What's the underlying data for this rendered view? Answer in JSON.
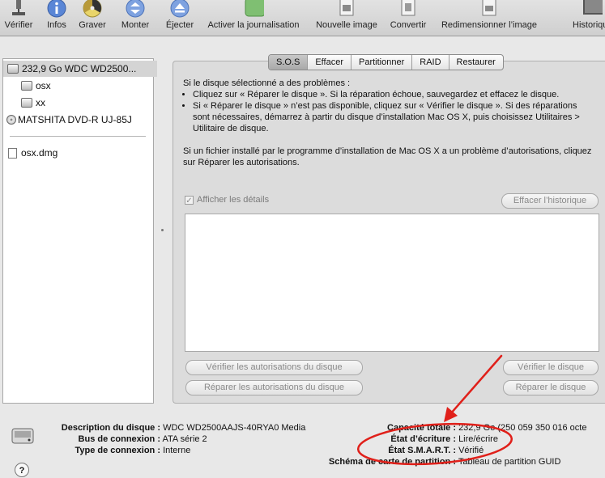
{
  "toolbar": {
    "items": [
      {
        "label": "Vérifier",
        "icon": "microscope-icon"
      },
      {
        "label": "Infos",
        "icon": "info-icon"
      },
      {
        "label": "Graver",
        "icon": "burn-icon"
      },
      {
        "label": "Monter",
        "icon": "mount-icon"
      },
      {
        "label": "Éjecter",
        "icon": "eject-icon"
      },
      {
        "label": "Activer la journalisation",
        "icon": "journal-icon"
      },
      {
        "label": "Nouvelle image",
        "icon": "new-image-icon"
      },
      {
        "label": "Convertir",
        "icon": "convert-icon"
      },
      {
        "label": "Redimensionner l’image",
        "icon": "resize-image-icon"
      },
      {
        "label": "Historique",
        "icon": "log-icon"
      }
    ]
  },
  "sidebar": {
    "items": [
      {
        "label": "232,9 Go WDC WD2500...",
        "kind": "disk"
      },
      {
        "label": "osx",
        "kind": "volume"
      },
      {
        "label": "xx",
        "kind": "volume"
      },
      {
        "label": "MATSHITA DVD-R UJ-85J",
        "kind": "optical"
      },
      {
        "label": "osx.dmg",
        "kind": "image"
      }
    ]
  },
  "tabs": [
    "S.O.S",
    "Effacer",
    "Partitionner",
    "RAID",
    "Restaurer"
  ],
  "sos": {
    "intro": "Si le disque sélectionné a des problèmes :",
    "bullets": [
      "Cliquez sur « Réparer le disque ». Si la réparation échoue, sauvegardez et effacez le disque.",
      "Si « Réparer le disque » n’est pas disponible, cliquez sur « Vérifier le disque ». Si des réparations sont nécessaires, démarrez à partir du disque d’installation Mac OS X, puis choisissez Utilitaires > Utilitaire de disque."
    ],
    "permissions_text": "Si un fichier installé par le programme d’installation de Mac OS X a un problème d’autorisations, cliquez sur Réparer les autorisations.",
    "show_details_label": "Afficher les détails",
    "show_details_checked": true,
    "clear_history_label": "Effacer l’historique",
    "verify_permissions_label": "Vérifier les autorisations du disque",
    "repair_permissions_label": "Réparer les autorisations du disque",
    "verify_disk_label": "Vérifier le disque",
    "repair_disk_label": "Réparer le disque"
  },
  "info": {
    "description_key": "Description du disque :",
    "description_val": "WDC WD2500AAJS-40RYA0 Media",
    "bus_key": "Bus de connexion :",
    "bus_val": "ATA série 2",
    "type_key": "Type de connexion :",
    "type_val": "Interne",
    "capacity_key": "Capacité totale :",
    "capacity_val": "232,9 Go (250 059 350 016 octe",
    "write_key": "État d’écriture :",
    "write_val": "Lire/écrire",
    "smart_key": "État S.M.A.R.T. :",
    "smart_val": "Vérifié",
    "partition_key": "Schéma de carte de partition :",
    "partition_val": "Tableau de partition GUID"
  },
  "help_label": "?",
  "colors": {
    "annotation": "#e0201a"
  }
}
